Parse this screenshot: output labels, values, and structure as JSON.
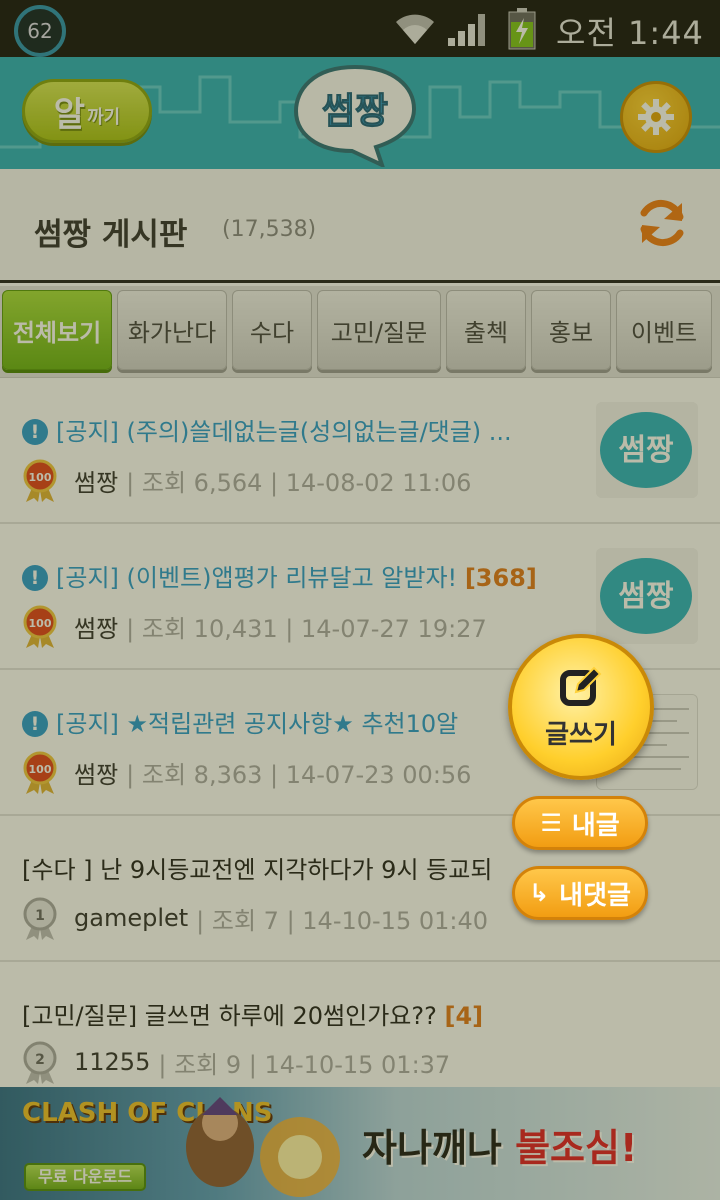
{
  "status_bar": {
    "notification_count": "62",
    "clock": "오전 1:44",
    "icons": [
      "wifi-icon",
      "signal-icon",
      "battery-charging-icon"
    ]
  },
  "header": {
    "left_button": {
      "big": "알",
      "small": "까기"
    },
    "logo_text": "썸짱",
    "settings_icon": "gear-icon"
  },
  "board": {
    "title": "썸짱 게시판",
    "count": "(17,538)",
    "refresh_icon": "refresh-icon"
  },
  "tabs": [
    {
      "label": "전체보기",
      "active": true
    },
    {
      "label": "화가난다",
      "active": false
    },
    {
      "label": "수다",
      "active": false
    },
    {
      "label": "고민/질문",
      "active": false
    },
    {
      "label": "출첵",
      "active": false
    },
    {
      "label": "홍보",
      "active": false
    },
    {
      "label": "이벤트",
      "active": false
    }
  ],
  "posts": [
    {
      "type": "notice",
      "title": "[공지] (주의)쓸데없는글(성의없는글/댓글) ...",
      "comments": "",
      "author": "썸짱",
      "views": "| 조회 6,564 | 14-08-02 11:06",
      "medal": "100",
      "thumbnail": "썸짱"
    },
    {
      "type": "notice",
      "title": "[공지] (이벤트)앱평가 리뷰달고 알받자!",
      "comments": "[368]",
      "author": "썸짱",
      "views": "| 조회 10,431 | 14-07-27 19:27",
      "medal": "100",
      "thumbnail": "썸짱"
    },
    {
      "type": "notice",
      "title": "[공지] ★적립관련 공지사항★ 추천10알",
      "comments": "",
      "author": "썸짱",
      "views": "| 조회 8,363 | 14-07-23 00:56",
      "medal": "100",
      "thumbnail": ""
    },
    {
      "type": "plain",
      "title": "[수다 ] 난 9시등교전엔 지각하다가 9시 등교되",
      "comments": "",
      "author": "gameplet",
      "views": "| 조회 7 | 14-10-15 01:40",
      "medal": "1"
    },
    {
      "type": "plain",
      "title": "[고민/질문] 글쓰면 하루에 20썸인가요??",
      "comments": "[4]",
      "author": "11255",
      "views": "| 조회 9 | 14-10-15 01:37",
      "medal": "2"
    }
  ],
  "fab": {
    "write_label": "글쓰기",
    "my_posts_label": "내글",
    "my_comments_label": "내댓글"
  },
  "ad": {
    "logo": "CLASH OF CLANS",
    "download": "무료 다운로드",
    "slogan_main": "자나깨나",
    "slogan_warn": "불조심!"
  }
}
